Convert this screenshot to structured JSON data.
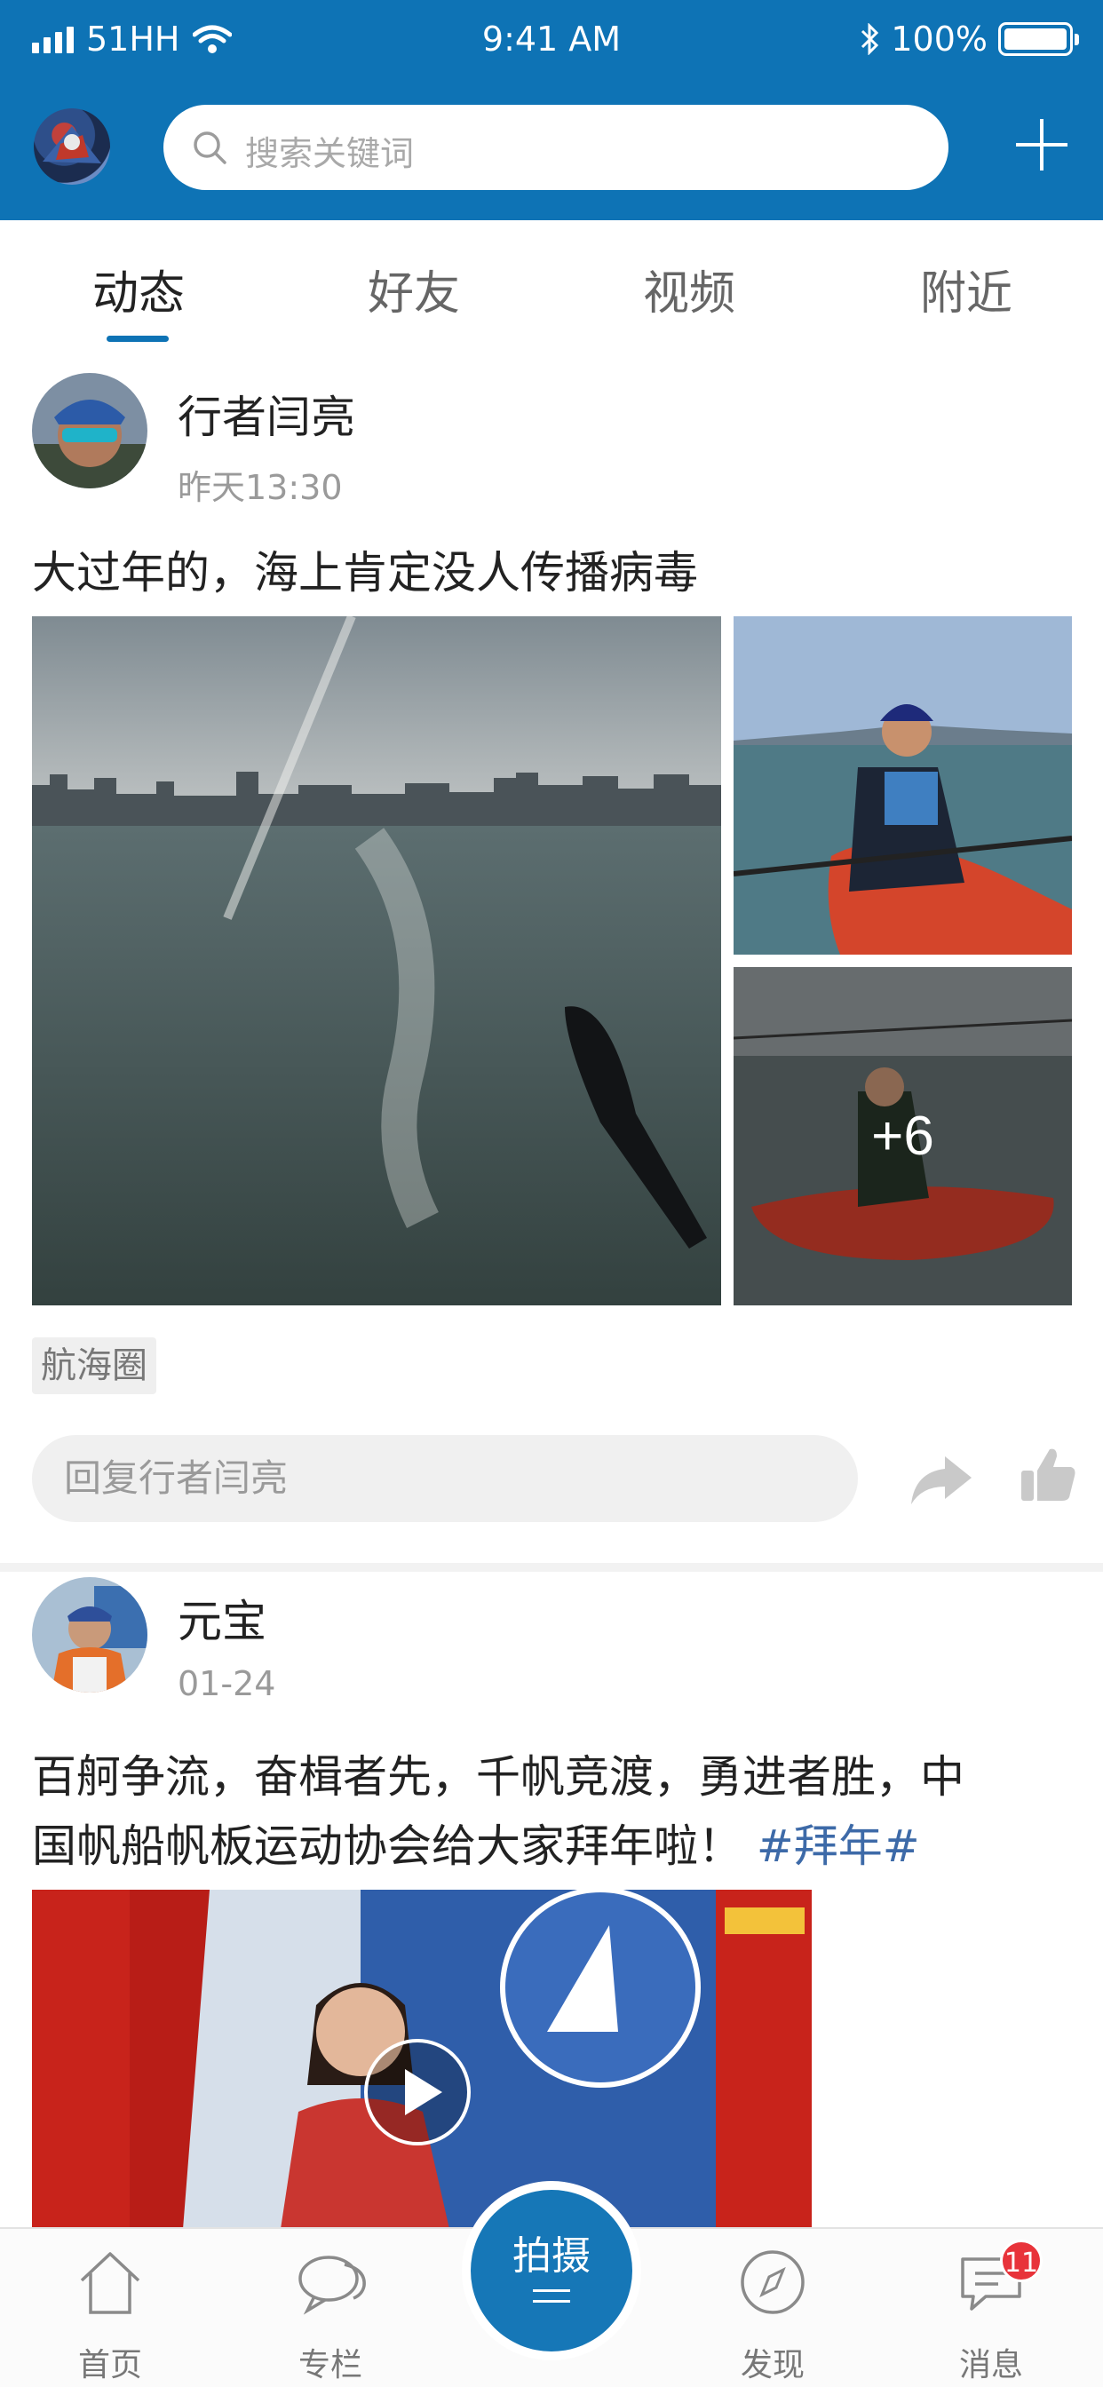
{
  "status_bar": {
    "carrier": "51HH",
    "time": "9:41 AM",
    "battery": "100%"
  },
  "header": {
    "search_placeholder": "搜索关键词",
    "icons": [
      "search-icon",
      "plus-icon"
    ]
  },
  "tabs": [
    {
      "label": "动态",
      "active": true
    },
    {
      "label": "好友",
      "active": false
    },
    {
      "label": "视频",
      "active": false
    },
    {
      "label": "附近",
      "active": false
    }
  ],
  "posts": [
    {
      "author": "行者闫亮",
      "time": "昨天13:30",
      "text": "大过年的，海上肯定没人传播病毒",
      "more_photos": "+6",
      "tag": "航海圈",
      "reply_placeholder": "回复行者闫亮"
    },
    {
      "author": "元宝",
      "time": "01-24",
      "text_line1": "百舸争流，奋楫者先，千帆竞渡，勇进者胜，中",
      "text_line2": "国帆船帆板运动协会给大家拜年啦！",
      "hashtag": "#拜年#"
    }
  ],
  "bottom_nav": {
    "items": [
      {
        "label": "首页",
        "icon": "home-icon"
      },
      {
        "label": "专栏",
        "icon": "chat-bubbles-icon"
      },
      {
        "label": "发现",
        "icon": "compass-icon"
      },
      {
        "label": "消息",
        "icon": "message-icon"
      }
    ],
    "center_label": "拍摄",
    "message_badge": "11"
  },
  "colors": {
    "brand": "#0e73b5",
    "badge": "#e8333a",
    "hashtag": "#3d6aa8"
  }
}
